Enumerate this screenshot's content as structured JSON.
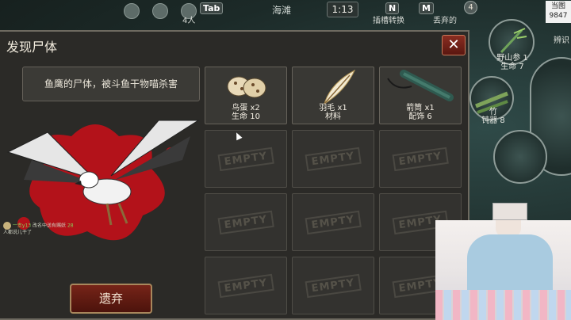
{
  "hud": {
    "player_count": "4人",
    "tab_key": "Tab",
    "map_name": "海滩",
    "time": "1:13",
    "n_key": "N",
    "n_label": "插槽转换",
    "m_key": "M",
    "m_label": "丢弃的",
    "badge": "4",
    "logo_line1": "当图",
    "logo_line2": "9847"
  },
  "skills": {
    "slot1_line1": "野山参 1",
    "slot1_line2": "生命 7",
    "slot2_line1": "竹",
    "slot2_line2": "钝器 8",
    "side_label": "辨识"
  },
  "panel": {
    "title": "发现尸体",
    "close_label": "✕",
    "description": "鱼鹰的尸体，被斗鱼干物喵杀害",
    "discard_label": "遗弃"
  },
  "chat": {
    "name": "一支y13",
    "line1": "改名中送有赐妖",
    "count": "28",
    "line2": "人都说儿干了"
  },
  "items": [
    {
      "name": "鸟蛋 x2",
      "stat": "生命 10",
      "art": "eggs"
    },
    {
      "name": "羽毛 x1",
      "stat": "材料",
      "art": "feather"
    },
    {
      "name": "箭筒 x1",
      "stat": "配饰 6",
      "art": "quiver"
    }
  ],
  "empty_label": "EMPTY",
  "colors": {
    "panel_bg": "#2b2a27",
    "button_red": "#762418",
    "blood_red": "#b3121a"
  }
}
